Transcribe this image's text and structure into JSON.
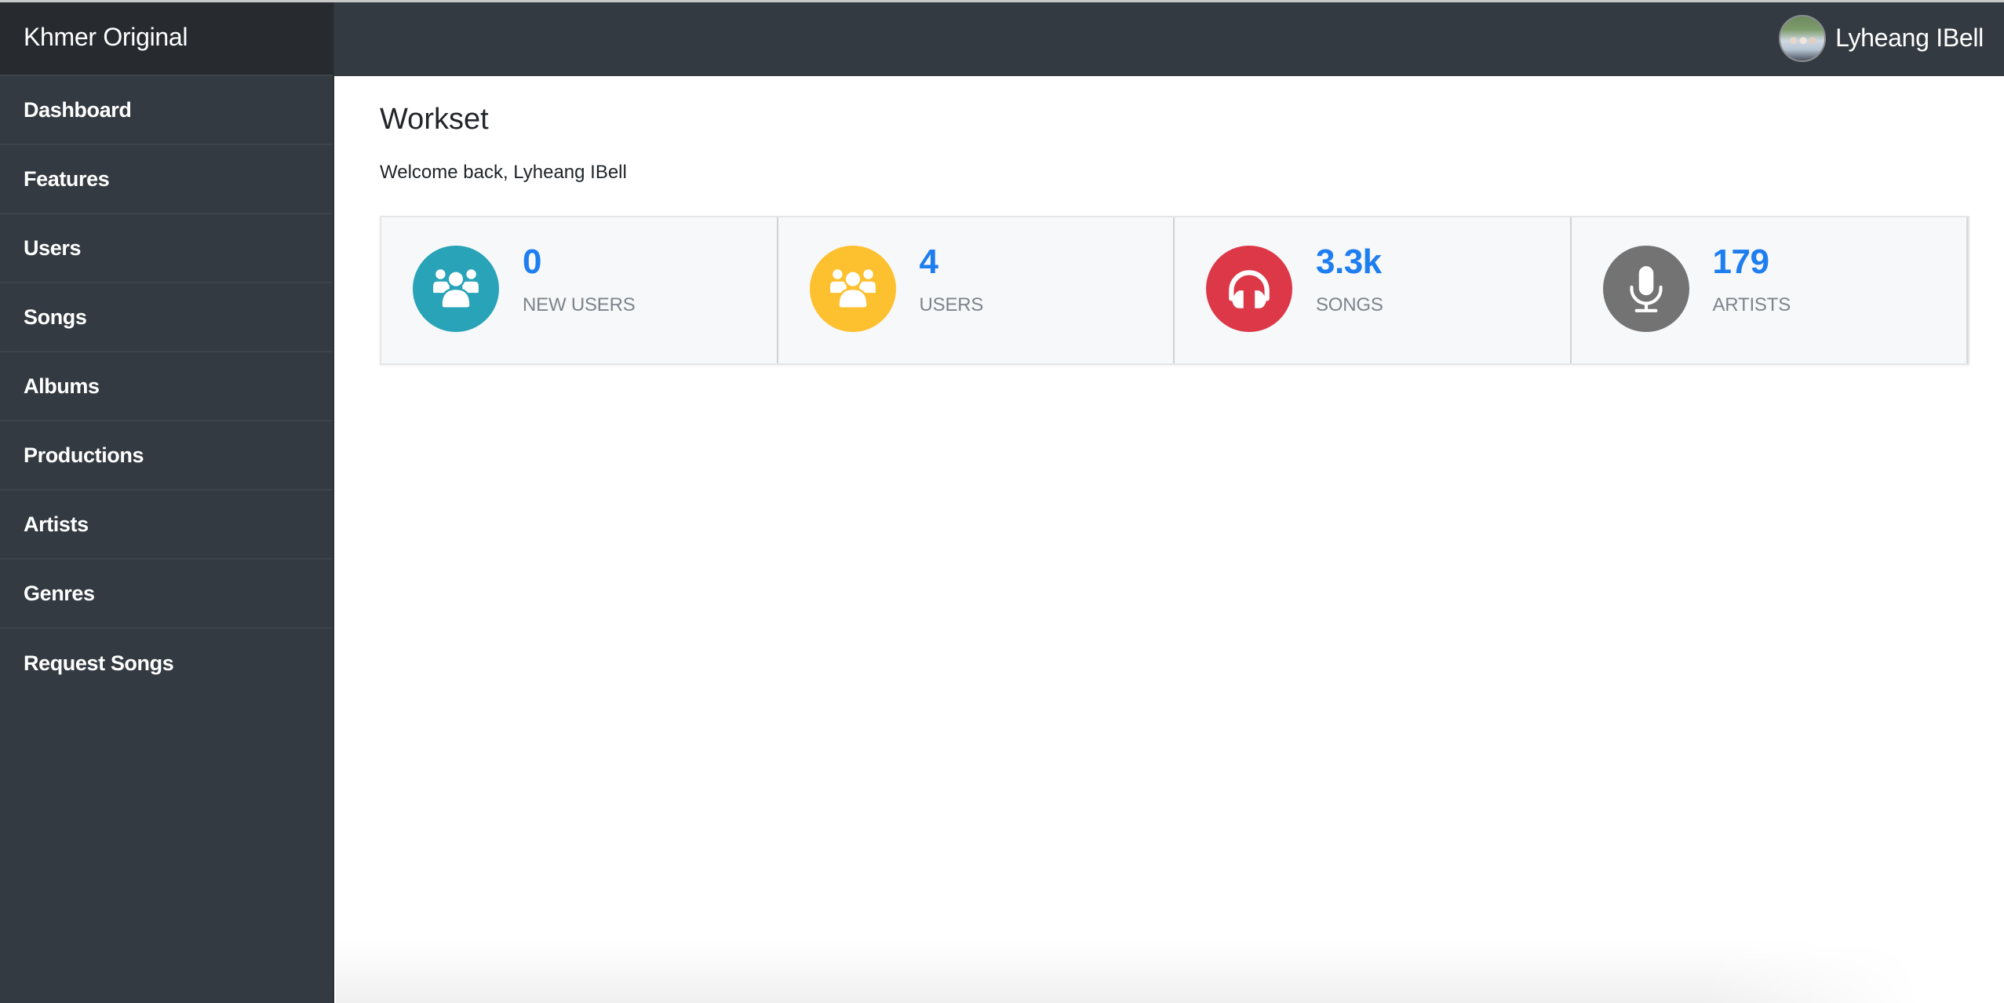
{
  "app": {
    "brand": "Khmer Original"
  },
  "sidebar": {
    "items": [
      {
        "label": "Dashboard"
      },
      {
        "label": "Features"
      },
      {
        "label": "Users"
      },
      {
        "label": "Songs"
      },
      {
        "label": "Albums"
      },
      {
        "label": "Productions"
      },
      {
        "label": "Artists"
      },
      {
        "label": "Genres"
      },
      {
        "label": "Request Songs"
      }
    ]
  },
  "header": {
    "user_name": "Lyheang IBell",
    "avatar_icon": "user-avatar-photo"
  },
  "main": {
    "title": "Workset",
    "welcome": "Welcome back, Lyheang IBell",
    "stats": [
      {
        "value": "0",
        "label": "NEW USERS",
        "icon": "users-icon",
        "color": "#28a3b8"
      },
      {
        "value": "4",
        "label": "USERS",
        "icon": "users-icon",
        "color": "#fdc02f"
      },
      {
        "value": "3.3k",
        "label": "SONGS",
        "icon": "headphones-icon",
        "color": "#dc3848"
      },
      {
        "value": "179",
        "label": "ARTISTS",
        "icon": "microphone-icon",
        "color": "#737373"
      }
    ]
  },
  "colors": {
    "sidebar_bg": "#343a41",
    "brand_bg": "#272b30",
    "stat_value": "#1e7ef0",
    "stat_label": "#7c848b"
  }
}
